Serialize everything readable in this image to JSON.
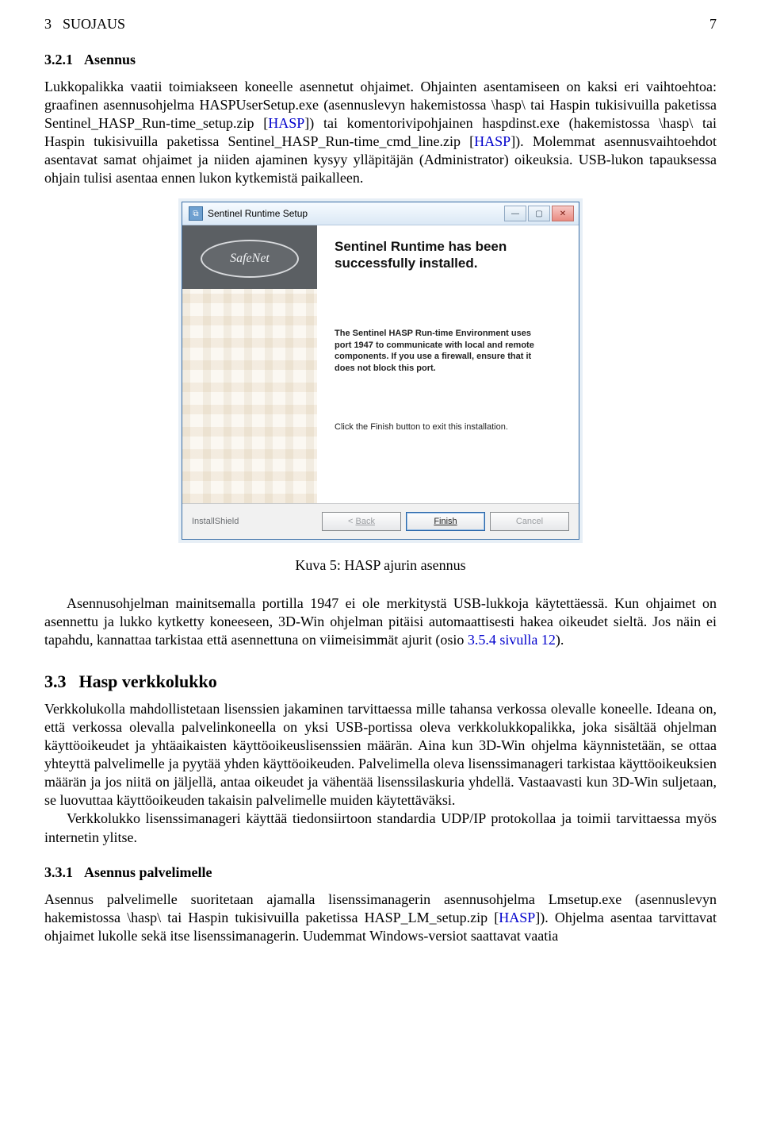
{
  "header": {
    "section_no": "3",
    "section_title": "SUOJAUS",
    "page_no": "7"
  },
  "s321": {
    "number": "3.2.1",
    "title": "Asennus",
    "p_a": "Lukkopalikka vaatii toimiakseen koneelle asennetut ohjaimet. Ohjainten asentamiseen on kaksi eri vaihtoehtoa: graafinen asennusohjelma HASPUserSetup.exe (asennuslevyn hakemistossa \\hasp\\ tai Haspin tukisivuilla paketissa Sentinel_HASP_Run-time_setup.zip [",
    "link1": "HASP",
    "p_b": "]) tai komentorivipohjainen haspdinst.exe (hakemistossa \\hasp\\ tai Haspin tukisivuilla paketissa Sentinel_HASP_Run-time_cmd_line.zip [",
    "link2": "HASP",
    "p_c": "]). Molemmat asennusvaihtoehdot asentavat samat ohjaimet ja niiden ajaminen kysyy ylläpitäjän (Administrator) oikeuksia. USB-lukon tapauksessa ohjain tulisi asentaa ennen lukon kytkemistä paikalleen."
  },
  "installer": {
    "title": "Sentinel Runtime Setup",
    "logo": "SafeNet",
    "headline": "Sentinel Runtime has been successfully installed.",
    "note": "The Sentinel HASP Run-time Environment uses port 1947 to communicate with local and remote components. If you use a firewall, ensure that it does not block this port.",
    "finish_hint": "Click the Finish button to exit this installation.",
    "installshield": "InstallShield",
    "btn_back_lt": "<",
    "btn_back_label": "Back",
    "btn_finish_label": "Finish",
    "btn_cancel_label": "Cancel",
    "win_min": "—",
    "win_max": "▢",
    "win_close": "✕"
  },
  "fig5_caption": "Kuva 5: HASP ajurin asennus",
  "after_fig": {
    "p_a": "Asennusohjelman mainitsemalla portilla 1947 ei ole merkitystä USB-lukkoja käytettäessä. Kun ohjaimet on asennettu ja lukko kytketty koneeseen, 3D-Win ohjelman pitäisi automaattisesti hakea oikeudet sieltä. Jos näin ei tapahdu, kannattaa tarkistaa että asennettuna on viimeisimmät ajurit (osio ",
    "link": "3.5.4 sivulla 12",
    "p_b": ")."
  },
  "s33": {
    "number": "3.3",
    "title": "Hasp verkkolukko",
    "para1": "Verkkolukolla mahdollistetaan lisenssien jakaminen tarvittaessa mille tahansa verkossa olevalle koneelle. Ideana on, että verkossa olevalla palvelinkoneella on yksi USB-portissa oleva verkkolukkopalikka, joka sisältää ohjelman käyttöoikeudet ja yhtäaikaisten käyttöoikeuslisenssien määrän. Aina kun 3D-Win ohjelma käynnistetään, se ottaa yhteyttä palvelimelle ja pyytää yhden käyttöoikeuden. Palvelimella oleva lisenssimanageri tarkistaa käyttöoikeuksien määrän ja jos niitä on jäljellä, antaa oikeudet ja vähentää lisenssilaskuria yhdellä. Vastaavasti kun 3D-Win suljetaan, se luovuttaa käyttöoikeuden takaisin palvelimelle muiden käytettäväksi.",
    "para2": "Verkkolukko lisenssimanageri käyttää tiedonsiirtoon standardia UDP/IP protokollaa ja toimii tarvittaessa myös internetin ylitse."
  },
  "s331": {
    "number": "3.3.1",
    "title": "Asennus palvelimelle",
    "p_a": "Asennus palvelimelle suoritetaan ajamalla lisenssimanagerin asennusohjelma Lmsetup.exe (asennuslevyn hakemistossa \\hasp\\ tai Haspin tukisivuilla paketissa HASP_LM_setup.zip [",
    "link": "HASP",
    "p_b": "]). Ohjelma asentaa tarvittavat ohjaimet lukolle sekä itse lisenssimanagerin. Uudemmat Windows-versiot saattavat vaatia"
  }
}
